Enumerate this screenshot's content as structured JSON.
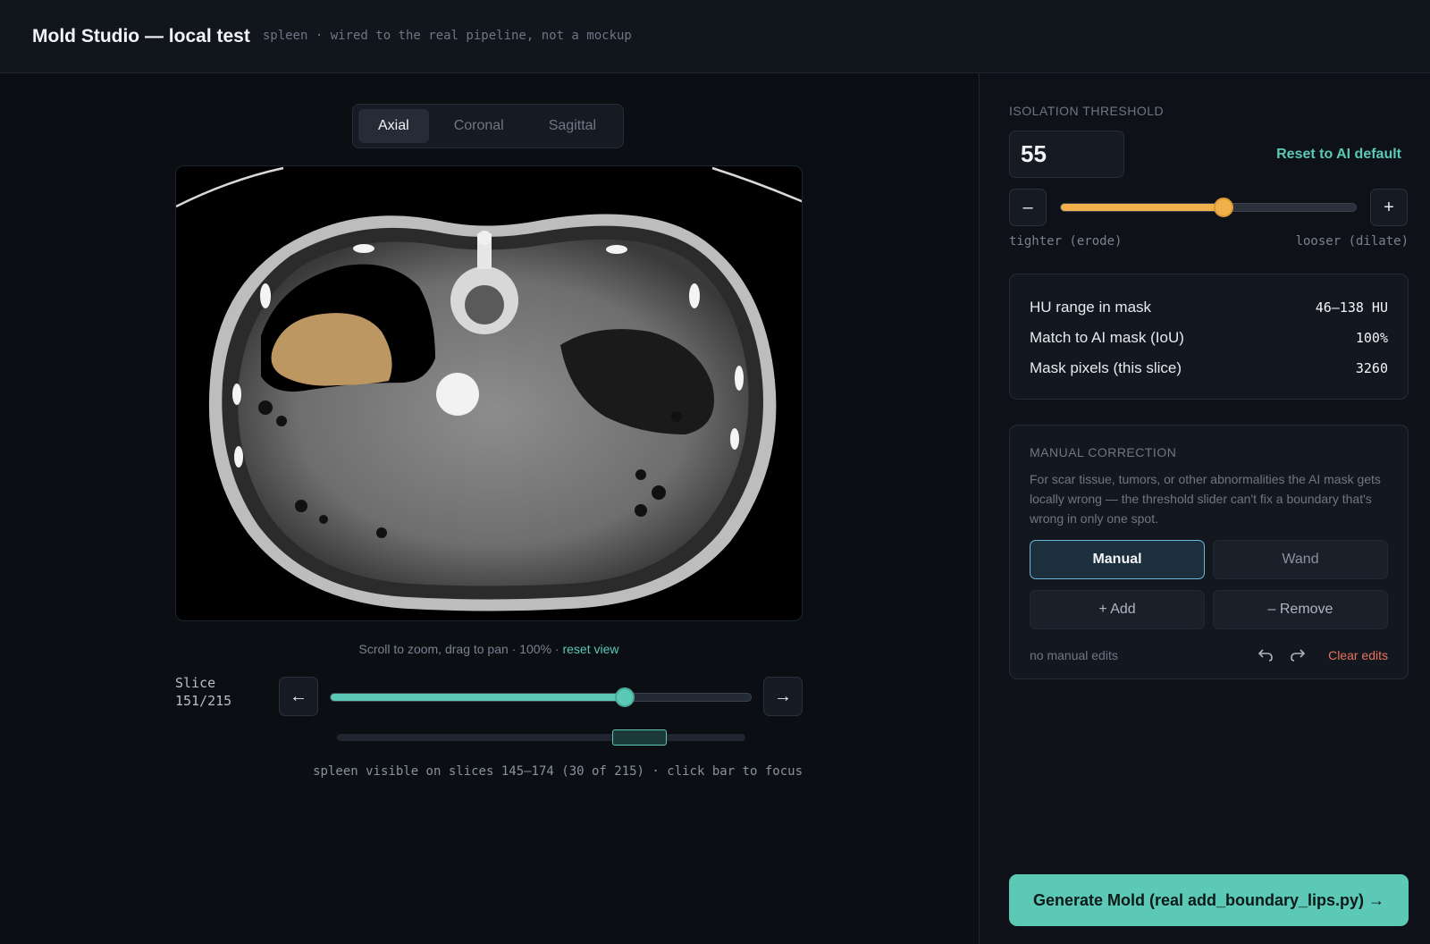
{
  "header": {
    "title": "Mold Studio — local test",
    "subtitle": "spleen · wired to the real pipeline, not a mockup"
  },
  "viewer": {
    "tabs": [
      {
        "label": "Axial",
        "active": true
      },
      {
        "label": "Coronal",
        "active": false
      },
      {
        "label": "Sagittal",
        "active": false
      }
    ],
    "zoom_hint": "Scroll to zoom, drag to pan · 100% · ",
    "reset_view": "reset view",
    "slice_label": "Slice",
    "slice_value": "151/215",
    "slice_current": 151,
    "slice_total": 215,
    "prev_icon": "←",
    "next_icon": "→",
    "organ_first_slice": 145,
    "organ_last_slice": 174,
    "organ_hint": "spleen visible on slices 145–174 (30 of 215) · click bar to focus",
    "mask_color": "#e7b877"
  },
  "threshold": {
    "label": "ISOLATION THRESHOLD",
    "value": "55",
    "fraction": 0.55,
    "reset_label": "Reset to AI default",
    "minus": "–",
    "plus": "+",
    "tighter": "tighter (erode)",
    "looser": "looser (dilate)"
  },
  "stats": [
    {
      "label": "HU range in mask",
      "value": "46–138 HU"
    },
    {
      "label": "Match to AI mask (IoU)",
      "value": "100%"
    },
    {
      "label": "Mask pixels (this slice)",
      "value": "3260"
    }
  ],
  "manual": {
    "title": "MANUAL CORRECTION",
    "description": "For scar tissue, tumors, or other abnormalities the AI mask gets locally wrong — the threshold slider can't fix a boundary that's wrong in only one spot.",
    "mode_manual": "Manual",
    "mode_wand": "Wand",
    "add": "+ Add",
    "remove": "– Remove",
    "status": "no manual edits",
    "clear": "Clear edits"
  },
  "generate_label": "Generate Mold (real add_boundary_lips.py) →",
  "colors": {
    "accent": "#5cc8b6",
    "threshold": "#f0b04c",
    "danger": "#e8735a"
  }
}
